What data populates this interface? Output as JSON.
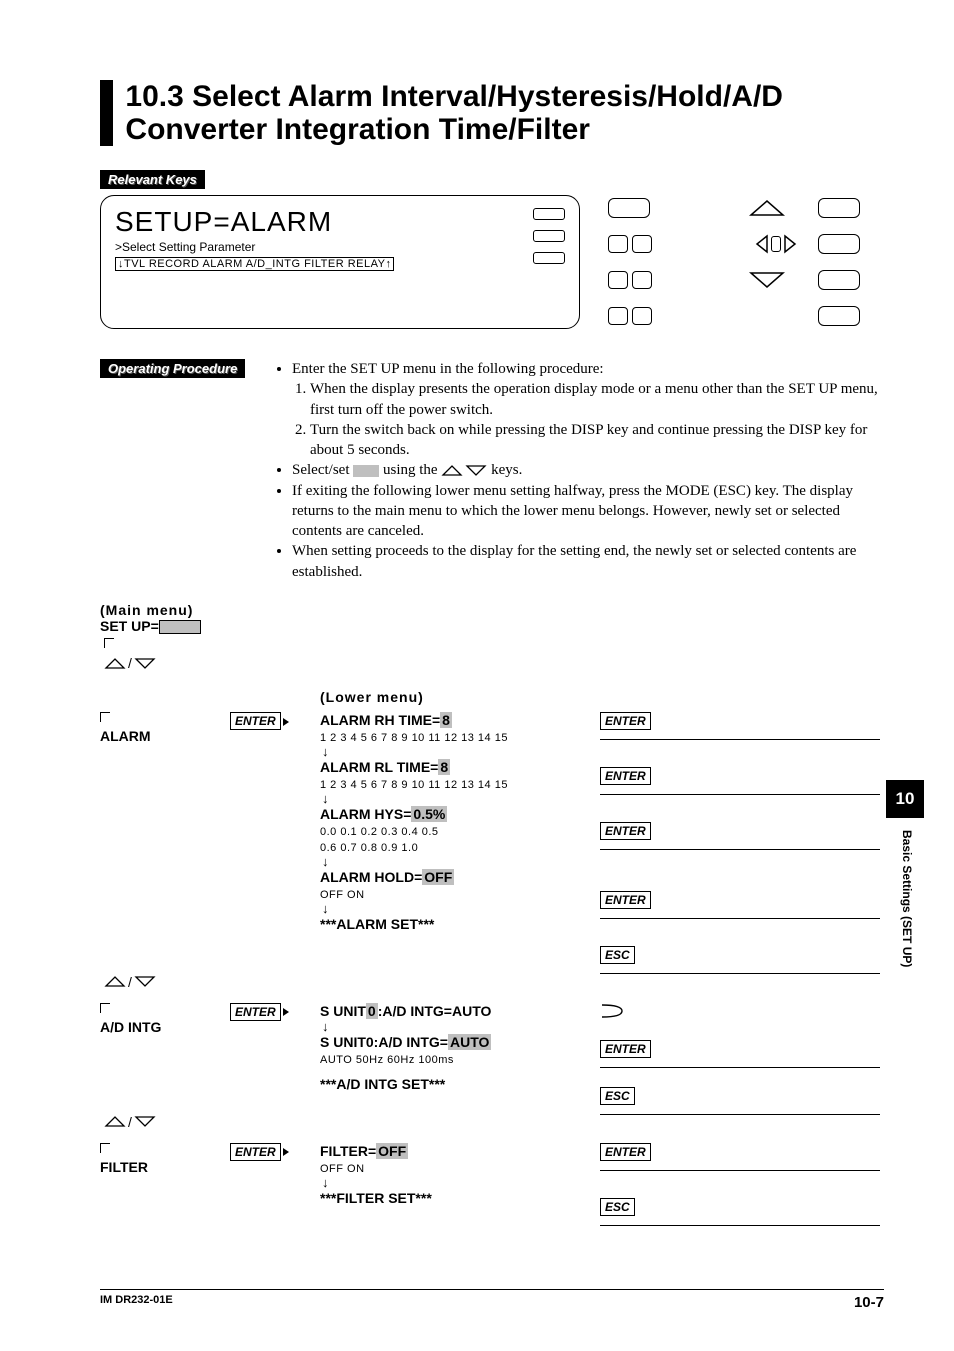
{
  "header": {
    "num": "10.3",
    "title": "Select Alarm Interval/Hysteresis/Hold/A/D Converter Integration Time/Filter"
  },
  "labels": {
    "relevant_keys": "Relevant Keys",
    "operating_procedure": "Operating Procedure"
  },
  "lcd": {
    "title": "SETUP=ALARM",
    "sub": ">Select Setting Parameter",
    "line": "↓TVL RECORD ALARM A/D_INTG FILTER RELAY↑"
  },
  "procedure": {
    "b1": "Enter the SET UP menu in the following procedure:",
    "s1": "When the display presents the operation display mode or a menu other than the SET UP menu, first turn off the power switch.",
    "s2": "Turn the switch back on while pressing the DISP key and continue pressing the DISP key for about 5 seconds.",
    "b2a": "Select/set ",
    "b2b": " using the ",
    "b2c": " keys.",
    "b3": "If exiting the following lower menu setting halfway, press the MODE (ESC) key.  The display returns to the main menu to which the lower menu belongs.  However, newly set or selected contents are canceled.",
    "b4": "When setting proceeds to the display for the setting end, the newly set or selected contents are established."
  },
  "flow": {
    "main_menu": "(Main menu)",
    "setup": "SET UP=",
    "lower_menu": "(Lower menu)",
    "enter": "ENTER",
    "esc": "ESC",
    "alarm": "ALARM",
    "adintg": "A/D INTG",
    "filter": "FILTER",
    "rh": {
      "label": "ALARM RH TIME=",
      "val": "8",
      "opts": "1 2 3 4 5 6 7 8 9 10 11 12 13 14 15"
    },
    "rl": {
      "label": "ALARM RL TIME=",
      "val": "8",
      "opts": "1 2 3 4 5 6 7 8 9 10 11 12 13 14 15"
    },
    "hys": {
      "label": "ALARM HYS=",
      "val": "0.5%",
      "opts1": "0.0  0.1  0.2  0.3  0.4  0.5",
      "opts2": "0.6  0.7  0.8  0.9  1.0"
    },
    "hold": {
      "label": "ALARM HOLD=",
      "val": "OFF",
      "opts": "OFF ON"
    },
    "alarm_set": "***ALARM SET***",
    "sunit_top": {
      "a": "S UNIT",
      "v": "0",
      "b": ":A/D INTG=AUTO"
    },
    "sunit": {
      "label": "S UNIT0:A/D INTG=",
      "val": "AUTO",
      "opts": "AUTO 50Hz 60Hz 100ms"
    },
    "adintg_set": "***A/D INTG SET***",
    "filter_item": {
      "label": "FILTER=",
      "val": "OFF",
      "opts": "OFF ON"
    },
    "filter_set": "***FILTER SET***"
  },
  "side": {
    "chapter": "10",
    "text": "Basic Settings (SET UP)"
  },
  "footer": {
    "left": "IM DR232-01E",
    "right": "10-7"
  }
}
